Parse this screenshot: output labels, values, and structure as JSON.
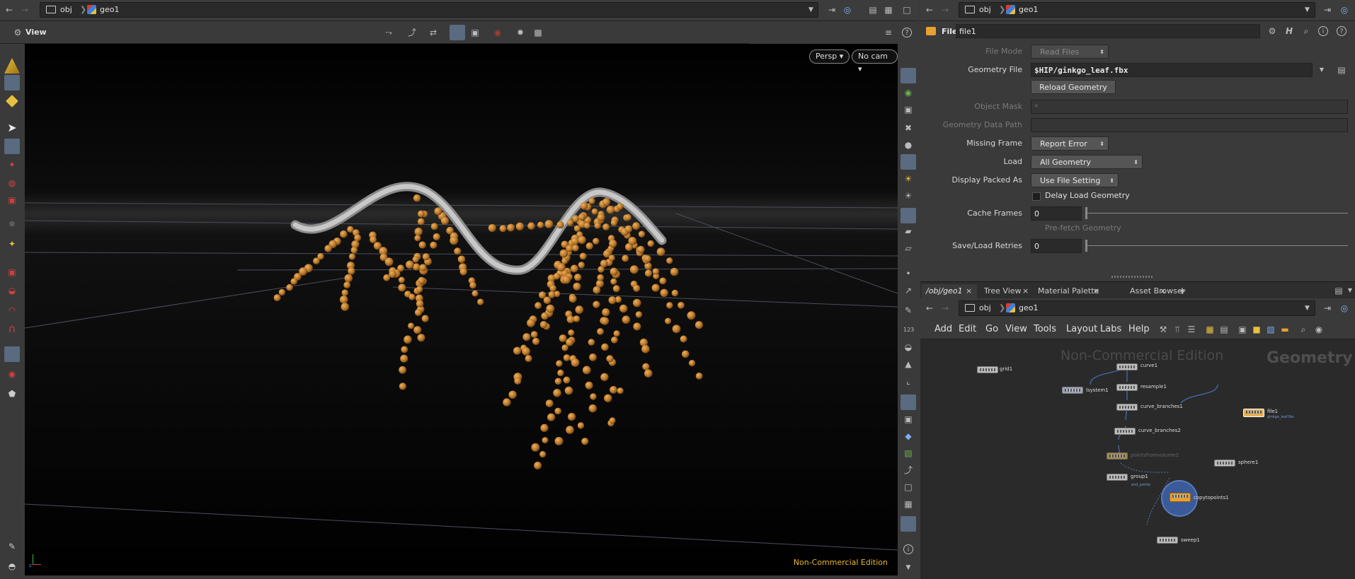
{
  "left_path": {
    "crumbs": [
      "obj",
      "geo1"
    ]
  },
  "viewer": {
    "title": "View",
    "persp_label": "Persp ▾",
    "cam_label": "No cam ▾",
    "watermark": "Non-Commercial Edition"
  },
  "params": {
    "path": {
      "crumbs": [
        "obj",
        "geo1"
      ]
    },
    "node_type": "File",
    "node_name": "file1",
    "file_mode": {
      "label": "File Mode",
      "value": "Read Files"
    },
    "geometry_file": {
      "label": "Geometry File",
      "value": "$HIP/ginkgo_leaf.fbx"
    },
    "reload_button": "Reload Geometry",
    "object_mask": {
      "label": "Object Mask",
      "value": "*"
    },
    "geometry_data_path": {
      "label": "Geometry Data Path",
      "value": ""
    },
    "missing_frame": {
      "label": "Missing Frame",
      "value": "Report Error"
    },
    "load": {
      "label": "Load",
      "value": "All Geometry"
    },
    "display_packed_as": {
      "label": "Display Packed As",
      "value": "Use File Setting"
    },
    "delay_load": {
      "label": "Delay Load Geometry",
      "checked": false
    },
    "cache_frames": {
      "label": "Cache Frames",
      "value": "0"
    },
    "prefetch": {
      "label": "Pre-fetch Geometry"
    },
    "save_load_retries": {
      "label": "Save/Load Retries",
      "value": "0"
    }
  },
  "network": {
    "tabs": [
      "/obj/geo1",
      "Tree View",
      "Material Palette",
      "Asset Browser"
    ],
    "tab_add": "+",
    "path": {
      "crumbs": [
        "obj",
        "geo1"
      ]
    },
    "menu": [
      "Add",
      "Edit",
      "Go",
      "View",
      "Tools",
      "Layout",
      "Labs",
      "Help"
    ],
    "watermark": "Non-Commercial Edition",
    "context_label": "Geometry",
    "nodes": [
      {
        "name": "grid1"
      },
      {
        "name": "curve1"
      },
      {
        "name": "resample1"
      },
      {
        "name": "lsystem1"
      },
      {
        "name": "curve_branches1"
      },
      {
        "name": "curve_branches2"
      },
      {
        "name": "pointsfromvolume1"
      },
      {
        "name": "group1"
      },
      {
        "name": "sphere1"
      },
      {
        "name": "copytopoints1"
      },
      {
        "name": "sweep1"
      },
      {
        "name": "file1",
        "sub": "ginkgo_leaf.fbx"
      }
    ],
    "wire_label": "end_points"
  }
}
